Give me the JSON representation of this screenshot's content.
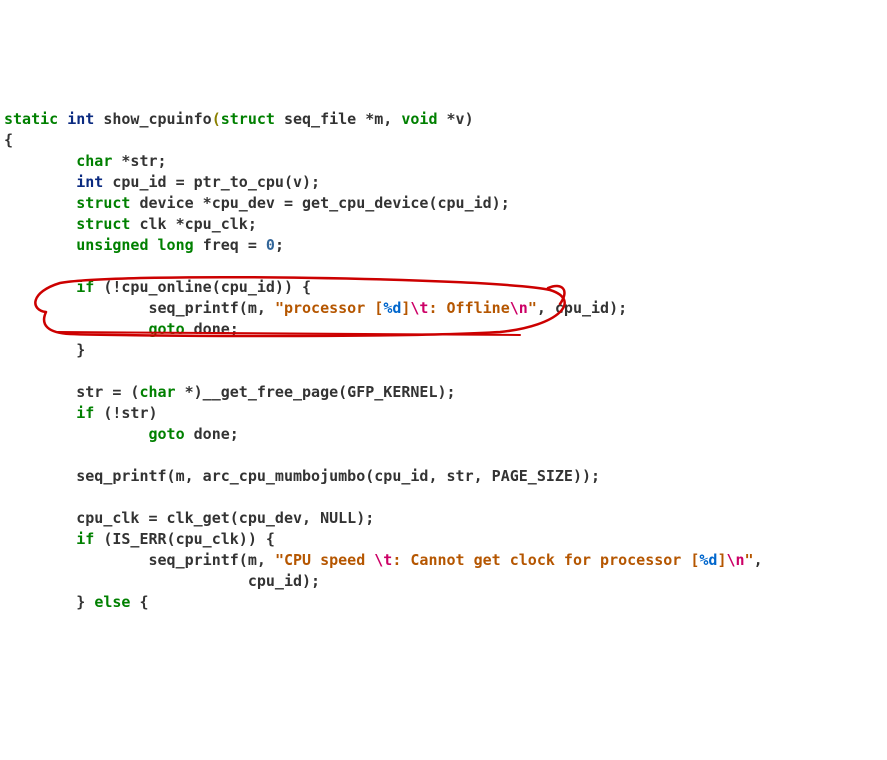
{
  "code": {
    "l1": {
      "a": "static",
      "b": "int",
      "c": "show_cpuinfo",
      "d": "struct",
      "e": "seq_file *m,",
      "f": "void",
      "g": "*v)"
    },
    "l2": "{",
    "l3": {
      "a": "char",
      "b": "*str;"
    },
    "l4": {
      "a": "int",
      "b": "cpu_id = ptr_to_cpu(v);"
    },
    "l5": {
      "a": "struct",
      "b": "device *cpu_dev = get_cpu_device(cpu_id);"
    },
    "l6": {
      "a": "struct",
      "b": "clk *cpu_clk;"
    },
    "l7": {
      "a": "unsigned",
      "b": "long",
      "c": "freq =",
      "d": "0",
      "e": ";"
    },
    "l8": "",
    "l9": {
      "a": "if",
      "b": "(!cpu_online(cpu_id)) {"
    },
    "l10": {
      "a": "seq_printf(m,",
      "b": "\"processor [",
      "c": "%d",
      "d": "]",
      "e": "\\t",
      "f": ": Offline",
      "g": "\\n",
      "h": "\"",
      "i": ", cpu_id);"
    },
    "l11": {
      "a": "goto",
      "b": "done;"
    },
    "l12": "}",
    "l13": "",
    "l14": {
      "a": "str = (",
      "b": "char",
      "c": "*)__get_free_page(GFP_KERNEL);"
    },
    "l15": {
      "a": "if",
      "b": "(!str)"
    },
    "l16": {
      "a": "goto",
      "b": "done;"
    },
    "l17": "",
    "l18": "seq_printf(m, arc_cpu_mumbojumbo(cpu_id, str, PAGE_SIZE));",
    "l19": "",
    "l20": "cpu_clk = clk_get(cpu_dev, NULL);",
    "l21": {
      "a": "if",
      "b": "(IS_ERR(cpu_clk)) {"
    },
    "l22": {
      "a": "seq_printf(m,",
      "b": "\"CPU speed ",
      "c": "\\t",
      "d": ": Cannot get clock for processor [",
      "e": "%d",
      "f": "]",
      "g": "\\n",
      "h": "\"",
      "i": ","
    },
    "l23": "cpu_id);",
    "l24": {
      "a": "}",
      "b": "else",
      "c": "{"
    }
  },
  "annotation": {
    "type": "hand-drawn-circle",
    "color": "#cc0000",
    "target_line": "str = (char *)__get_free_page(GFP_KERNEL);"
  }
}
